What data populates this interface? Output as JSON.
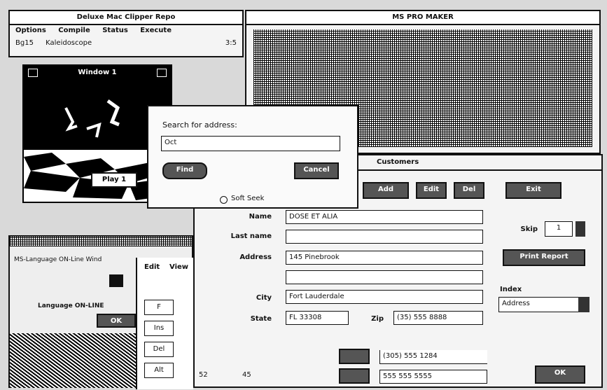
{
  "music_window": {
    "title": "Deluxe Mac Clipper Repo",
    "menu": [
      "Options",
      "Compile",
      "Status",
      "Execute"
    ],
    "submenu": [
      "Bg15",
      "Kaleidoscope"
    ],
    "counter": "3:5"
  },
  "graphics_window": {
    "title": "Window 1",
    "button": "Play 1"
  },
  "search_dialog": {
    "prompt": "Search for address:",
    "value": "Oct",
    "find_label": "Find",
    "cancel_label": "Cancel",
    "option_label": "Soft Seek"
  },
  "main_window": {
    "title": "MS PRO MAKER"
  },
  "form_window": {
    "title": "Customers",
    "toolbar": [
      "Add",
      "Edit",
      "Del",
      "Exit"
    ],
    "labels": {
      "name": "Name",
      "last_name": "Last name",
      "address": "Address",
      "city": "City",
      "state": "State",
      "zip": "Zip"
    },
    "values": {
      "name": "DOSE ET ALIA",
      "last_name": "",
      "address": "145 Pinebrook",
      "address2": "",
      "city": "Fort Lauderdale",
      "state": "FL 33308",
      "zip": "(35) 555 8888"
    },
    "skip_label": "Skip",
    "skip_value": "1",
    "action_button": "Print Report",
    "index_label": "Index",
    "index_value": "Address",
    "phone1": "(305) 555 1284",
    "phone2": "555 555 5555",
    "ok_label": "OK"
  },
  "lower_left": {
    "title": "MS-Language ON-Line Wind",
    "text": "Language ON-LINE",
    "button": "OK",
    "menu": [
      "Edit",
      "View"
    ],
    "keys": [
      "F",
      "Ins",
      "Del",
      "Alt"
    ],
    "coords": [
      "52",
      "45"
    ]
  }
}
